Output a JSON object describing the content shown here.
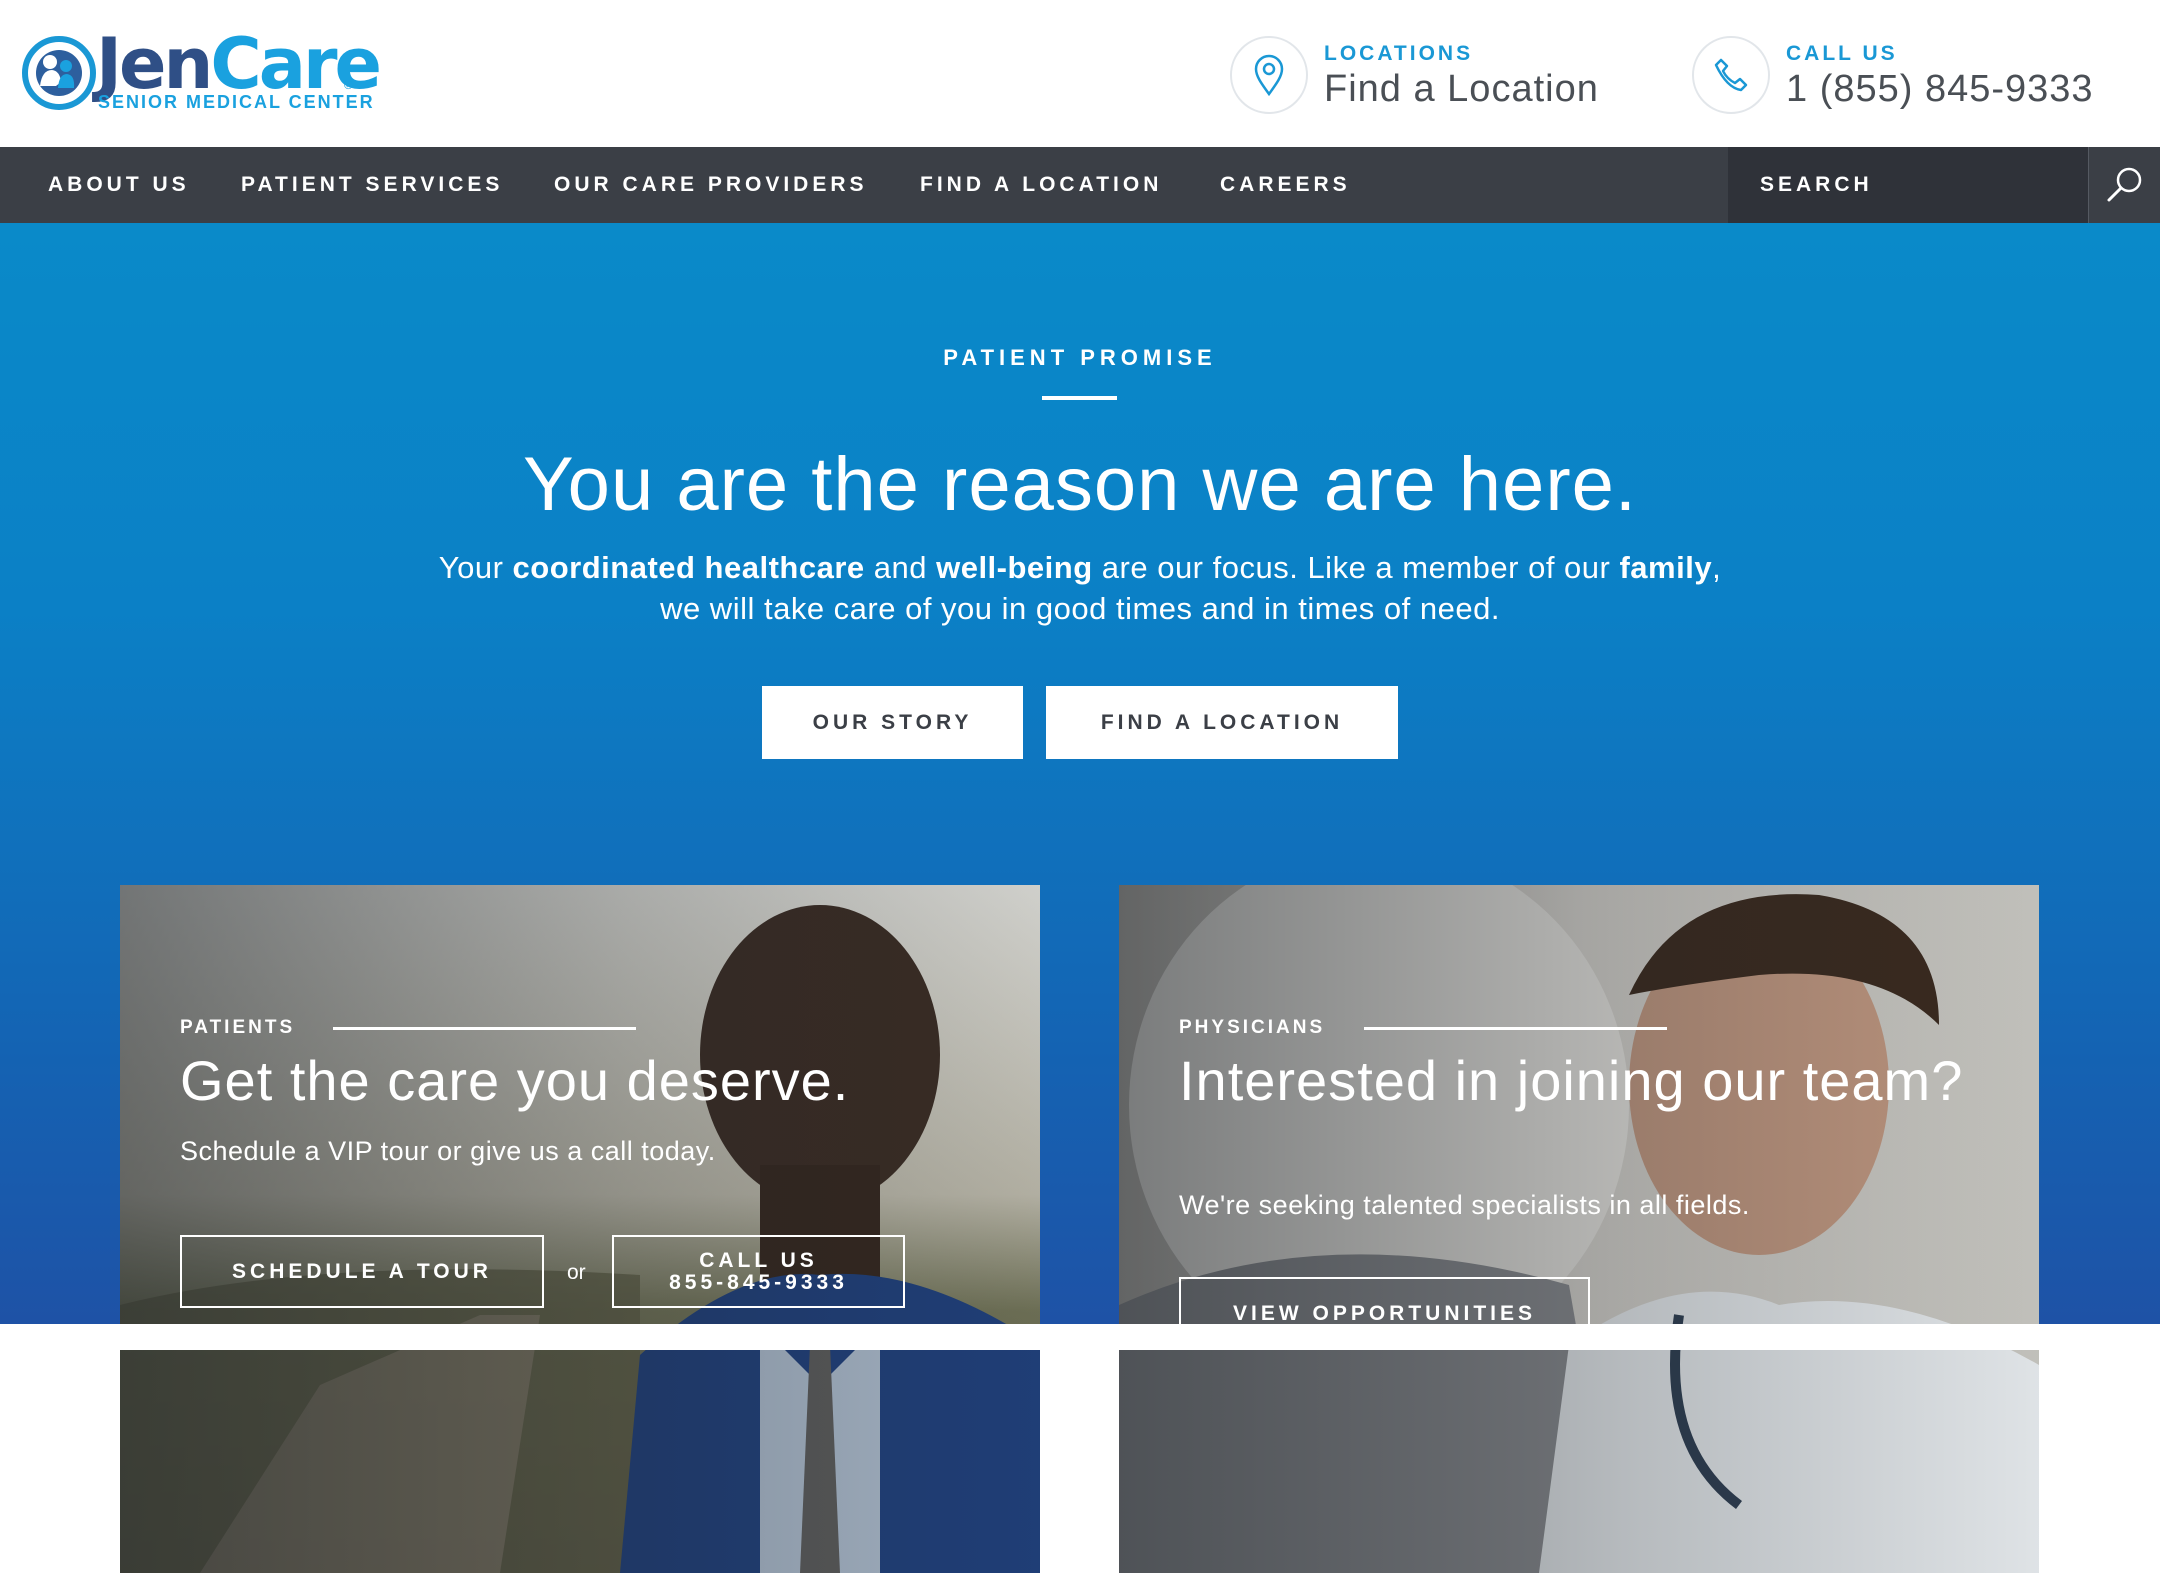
{
  "brand": {
    "name_part1": "Jen",
    "name_part2": "Care",
    "registered": "®",
    "tagline": "SENIOR MEDICAL CENTER",
    "primary_color": "#1a98d5",
    "dark_color": "#2f4f86"
  },
  "header": {
    "locations": {
      "icon": "map-pin-icon",
      "label": "LOCATIONS",
      "value": "Find a Location"
    },
    "call": {
      "icon": "phone-icon",
      "label": "CALL US",
      "value": "1 (855) 845-9333"
    }
  },
  "nav": {
    "items": [
      {
        "label": "ABOUT US"
      },
      {
        "label": "PATIENT SERVICES"
      },
      {
        "label": "OUR CARE PROVIDERS"
      },
      {
        "label": "FIND A LOCATION"
      },
      {
        "label": "CAREERS"
      }
    ],
    "search": {
      "placeholder": "SEARCH",
      "icon": "search-icon"
    },
    "bg_color": "#3b3f46"
  },
  "hero": {
    "eyebrow": "PATIENT PROMISE",
    "headline": "You are the reason we are here.",
    "sub": {
      "t1": "Your ",
      "b1": "coordinated healthcare",
      "t2": " and ",
      "b2": "well-being",
      "t3": " are our focus. Like a member of our ",
      "b3": "family",
      "t4": ", we will take care of you in good times and in times of need."
    },
    "buttons": {
      "our_story": "OUR STORY",
      "find_location": "FIND A LOCATION"
    },
    "gradient": [
      "#0a8ac9",
      "#1e52a6"
    ]
  },
  "cards": {
    "patients": {
      "eyebrow": "PATIENTS",
      "title": "Get the care you deserve.",
      "text": "Schedule a VIP tour or give us a call today.",
      "schedule_button": "SCHEDULE A TOUR",
      "or": "or",
      "call_button_line1": "CALL US",
      "call_button_line2": "855-845-9333"
    },
    "physicians": {
      "eyebrow": "PHYSICIANS",
      "title": "Interested in joining our team?",
      "text": "We're seeking talented specialists in all fields.",
      "button": "VIEW OPPORTUNITIES"
    }
  }
}
